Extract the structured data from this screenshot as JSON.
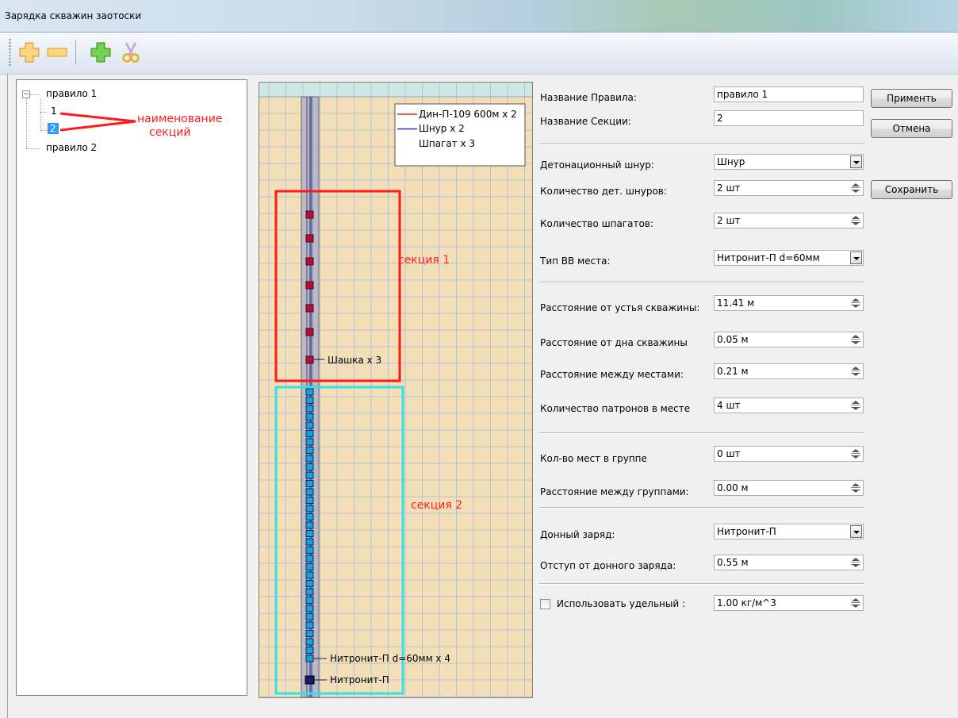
{
  "window": {
    "title": "Зарядка скважин заотоски"
  },
  "toolbar": {
    "buttons": [
      {
        "icon": "plus-orange-icon"
      },
      {
        "icon": "minus-orange-icon"
      },
      {
        "icon": "plus-green-icon"
      },
      {
        "icon": "scissors-icon"
      }
    ]
  },
  "tree": {
    "rule1": "правило 1",
    "section1": "1",
    "section2": "2",
    "rule2": "правило 2",
    "annotation": [
      "наименование",
      "секций"
    ]
  },
  "diagram": {
    "legend": [
      {
        "label": "Дин-П-109 600м x 2",
        "color": "#e02020"
      },
      {
        "label": "Шнур x 2",
        "color": "#2030c0"
      },
      {
        "label": "Шпагат x 3",
        "color": "#ffffff"
      }
    ],
    "charge_labels": {
      "shashka": "Шашка x 3",
      "nitronit_place": "Нитронит-П d=60мм x 4",
      "bottom": "Нитронит-П"
    },
    "section_labels": {
      "section1": "секция 1",
      "section2": "секция 2"
    },
    "colors": {
      "section1_box": "#ff1a1a",
      "section2_box": "#33e0e8",
      "shashka": "#b0103a",
      "cartridge": "#1aa0e0",
      "bottom_charge": "#1a1a60",
      "background": "#f2dfb8"
    }
  },
  "form": {
    "rule_name": {
      "label": "Название Правила:",
      "value": "правило 1"
    },
    "section_name": {
      "label": "Название Секции:",
      "value": "2"
    },
    "det_cord": {
      "label": "Детонационный шнур:",
      "value": "Шнур"
    },
    "det_cord_count": {
      "label": "Количество дет. шнуров:",
      "value": "2 шт"
    },
    "twine_count": {
      "label": "Количество шпагатов:",
      "value": "2 шт"
    },
    "explosive_type": {
      "label": "Тип ВВ места:",
      "value": "Нитронит-П d=60мм"
    },
    "dist_mouth": {
      "label": "Расстояние от устья скважины:",
      "value": "11.41 м"
    },
    "dist_bottom": {
      "label": "Расстояние от дна скважины",
      "value": "0.05 м"
    },
    "dist_places": {
      "label": "Расстояние между местами:",
      "value": "0.21 м"
    },
    "cartridges_per_place": {
      "label": "Количество патронов в месте",
      "value": "4 шт"
    },
    "places_in_group": {
      "label": "Кол-во мест в группе",
      "value": "0 шт"
    },
    "dist_groups": {
      "label": "Расстояние между группами:",
      "value": "0.00 м"
    },
    "bottom_charge": {
      "label": "Донный заряд:",
      "value": "Нитронит-П"
    },
    "bottom_offset": {
      "label": "Отступ от донного заряда:",
      "value": "0.55 м"
    },
    "use_specific": {
      "label": "Использовать удельный :",
      "value": "1.00 кг/м^3",
      "checked": false
    }
  },
  "buttons": {
    "apply": "Применть",
    "cancel": "Отмена",
    "save": "Сохранить"
  }
}
